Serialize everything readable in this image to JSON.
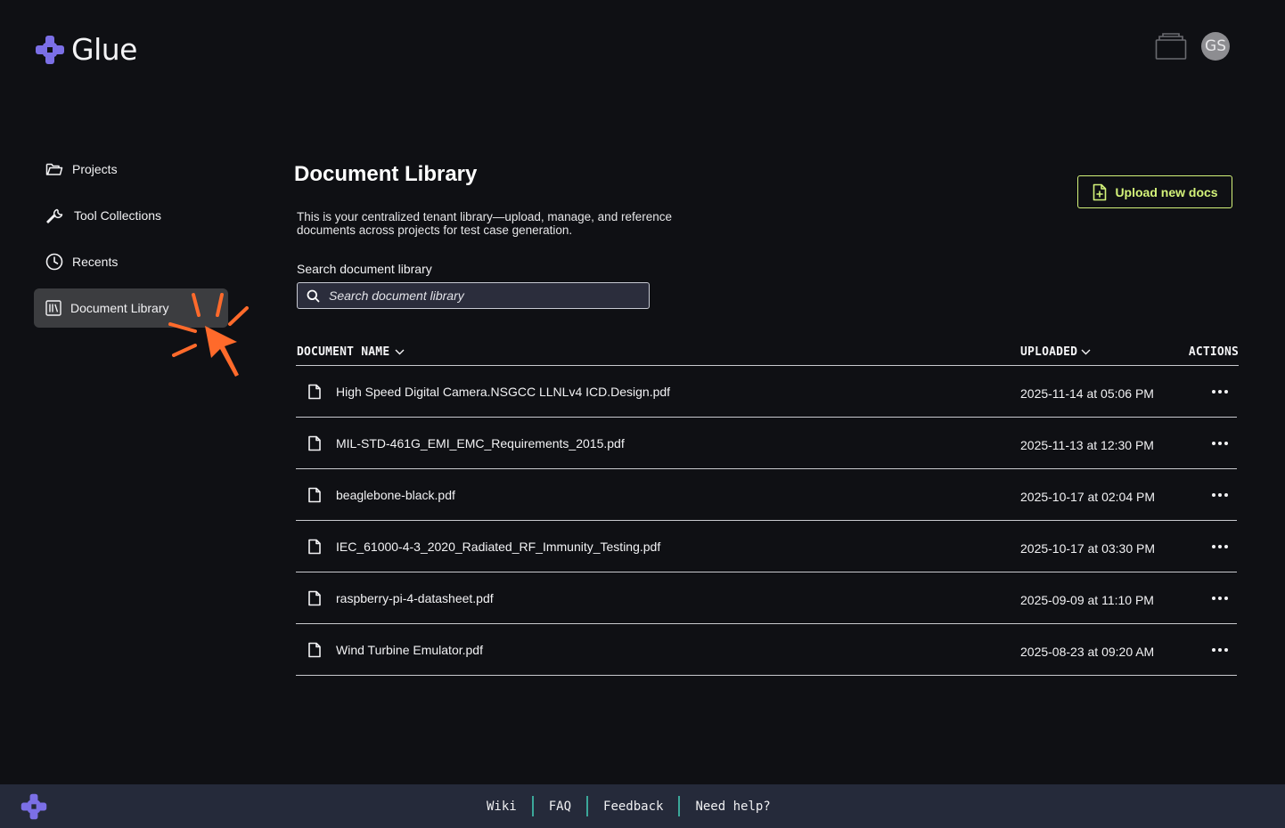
{
  "app": {
    "name": "Glue"
  },
  "header": {
    "avatar_initials": "GS"
  },
  "sidebar": {
    "items": [
      {
        "label": "Projects",
        "icon": "folder-icon"
      },
      {
        "label": "Tool Collections",
        "icon": "wrench-icon"
      },
      {
        "label": "Recents",
        "icon": "clock-icon"
      },
      {
        "label": "Document Library",
        "icon": "library-icon",
        "active": true
      }
    ]
  },
  "main": {
    "title": "Document Library",
    "description": "This is your centralized tenant library—upload, manage, and reference documents across projects for test case generation.",
    "upload_button": "Upload new docs",
    "search": {
      "label": "Search document library",
      "placeholder": "Search document library",
      "value": ""
    },
    "table": {
      "columns": {
        "name": "DOCUMENT NAME",
        "uploaded": "UPLOADED",
        "actions": "ACTIONS"
      },
      "rows": [
        {
          "name": "High Speed Digital Camera.NSGCC LLNLv4 ICD.Design.pdf",
          "uploaded": "2025-11-14 at 05:06 PM"
        },
        {
          "name": "MIL-STD-461G_EMI_EMC_Requirements_2015.pdf",
          "uploaded": "2025-11-13 at 12:30 PM"
        },
        {
          "name": "beaglebone-black.pdf",
          "uploaded": "2025-10-17 at 02:04 PM"
        },
        {
          "name": "IEC_61000-4-3_2020_Radiated_RF_Immunity_Testing.pdf",
          "uploaded": "2025-10-17 at 03:30 PM"
        },
        {
          "name": "raspberry-pi-4-datasheet.pdf",
          "uploaded": "2025-09-09 at 11:10 PM"
        },
        {
          "name": "Wind Turbine Emulator.pdf",
          "uploaded": "2025-08-23 at 09:20 AM"
        }
      ]
    }
  },
  "footer": {
    "links": [
      "Wiki",
      "FAQ",
      "Feedback",
      "Need help?"
    ]
  },
  "colors": {
    "background": "#0f1014",
    "accent": "#d4f37a",
    "brand": "#7b6fe6",
    "footer_bg": "#252a3a",
    "footer_separator": "#3ba79a",
    "click_indicator": "#ff6a2b"
  }
}
